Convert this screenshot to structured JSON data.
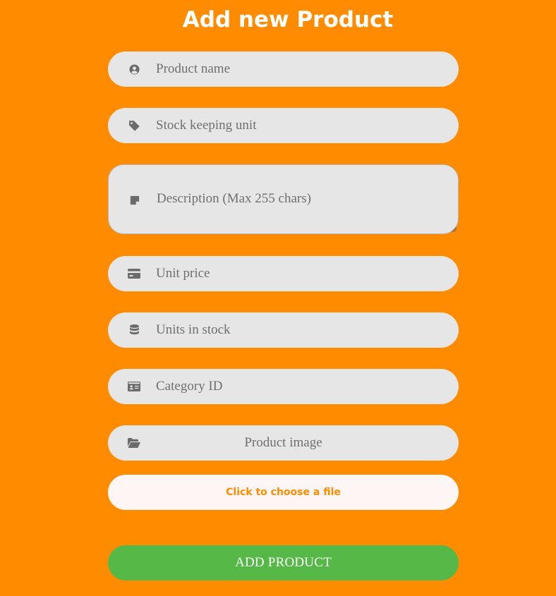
{
  "page": {
    "title": "Add new Product"
  },
  "form": {
    "product_name": {
      "placeholder": "Product name",
      "icon": "user-circle-icon"
    },
    "sku": {
      "placeholder": "Stock keeping unit",
      "icon": "tag-icon"
    },
    "description": {
      "placeholder": "Description (Max 255 chars)",
      "icon": "sticky-note-icon"
    },
    "unit_price": {
      "placeholder": "Unit price",
      "icon": "credit-card-icon"
    },
    "units_in_stock": {
      "placeholder": "Units in stock",
      "icon": "database-icon"
    },
    "category_id": {
      "placeholder": "Category ID",
      "icon": "id-card-icon"
    },
    "product_image": {
      "label": "Product image",
      "icon": "folder-open-icon"
    },
    "choose_file_label": "Click to choose a file",
    "submit_label": "ADD PRODUCT"
  },
  "colors": {
    "background": "#ff8c00",
    "field": "#e6e6e6",
    "icon": "#6b6b6b",
    "submit": "#56b947",
    "file_button": "#fdf6f4",
    "file_button_text": "#ff8c00"
  }
}
